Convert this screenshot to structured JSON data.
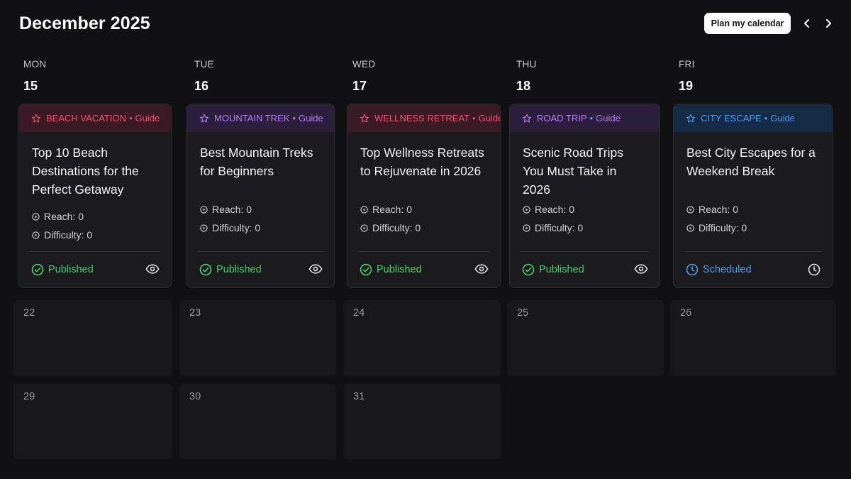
{
  "header": {
    "title": "December 2025",
    "plan_button": "Plan my calendar",
    "prev_icon": "chevron-left-icon",
    "next_icon": "chevron-right-icon"
  },
  "week": [
    {
      "dow": "MON",
      "num": "15"
    },
    {
      "dow": "TUE",
      "num": "16"
    },
    {
      "dow": "WED",
      "num": "17"
    },
    {
      "dow": "THU",
      "num": "18"
    },
    {
      "dow": "FRI",
      "num": "19"
    }
  ],
  "cards": [
    {
      "category": "BEACH VACATION",
      "separator": "•",
      "type": "Guide",
      "title": "Top 10 Beach Destinations for the Perfect Getaway",
      "reach": "Reach: 0",
      "difficulty": "Difficulty: 0",
      "status": "Published",
      "status_icon": "check-circle-icon",
      "action_icon": "eye-icon",
      "accent": "#f0507a",
      "tag_bg": "#3a1a24"
    },
    {
      "category": "MOUNTAIN TREK",
      "separator": "•",
      "type": "Guide",
      "title": "Best Mountain Treks for Beginners",
      "reach": "Reach: 0",
      "difficulty": "Difficulty: 0",
      "status": "Published",
      "status_icon": "check-circle-icon",
      "action_icon": "eye-icon",
      "accent": "#b77cf0",
      "tag_bg": "#2c1f3e"
    },
    {
      "category": "WELLNESS RETREAT",
      "separator": "•",
      "type": "Guide",
      "title": "Top Wellness Retreats to Rejuvenate in 2026",
      "reach": "Reach: 0",
      "difficulty": "Difficulty: 0",
      "status": "Published",
      "status_icon": "check-circle-icon",
      "action_icon": "eye-icon",
      "accent": "#f0507a",
      "tag_bg": "#3a1a24"
    },
    {
      "category": "ROAD TRIP",
      "separator": "•",
      "type": "Guide",
      "title": "Scenic Road Trips You Must Take in 2026",
      "reach": "Reach: 0",
      "difficulty": "Difficulty: 0",
      "status": "Published",
      "status_icon": "check-circle-icon",
      "action_icon": "eye-icon",
      "accent": "#b77cf0",
      "tag_bg": "#2c1f3e"
    },
    {
      "category": "CITY ESCAPE",
      "separator": "•",
      "type": "Guide",
      "title": "Best City Escapes for a Weekend Break",
      "reach": "Reach: 0",
      "difficulty": "Difficulty: 0",
      "status": "Scheduled",
      "status_icon": "clock-icon",
      "action_icon": "clock-icon",
      "accent": "#4aa0f0",
      "tag_bg": "#152a44"
    }
  ],
  "later_weeks": [
    [
      "22",
      "23",
      "24",
      "25",
      "26"
    ],
    [
      "29",
      "30",
      "31"
    ]
  ],
  "colors": {
    "background": "#111113",
    "card": "#1b1b1e",
    "published": "#3fcf6a",
    "scheduled": "#4aa0f0",
    "empty_cell": "#18181b"
  }
}
